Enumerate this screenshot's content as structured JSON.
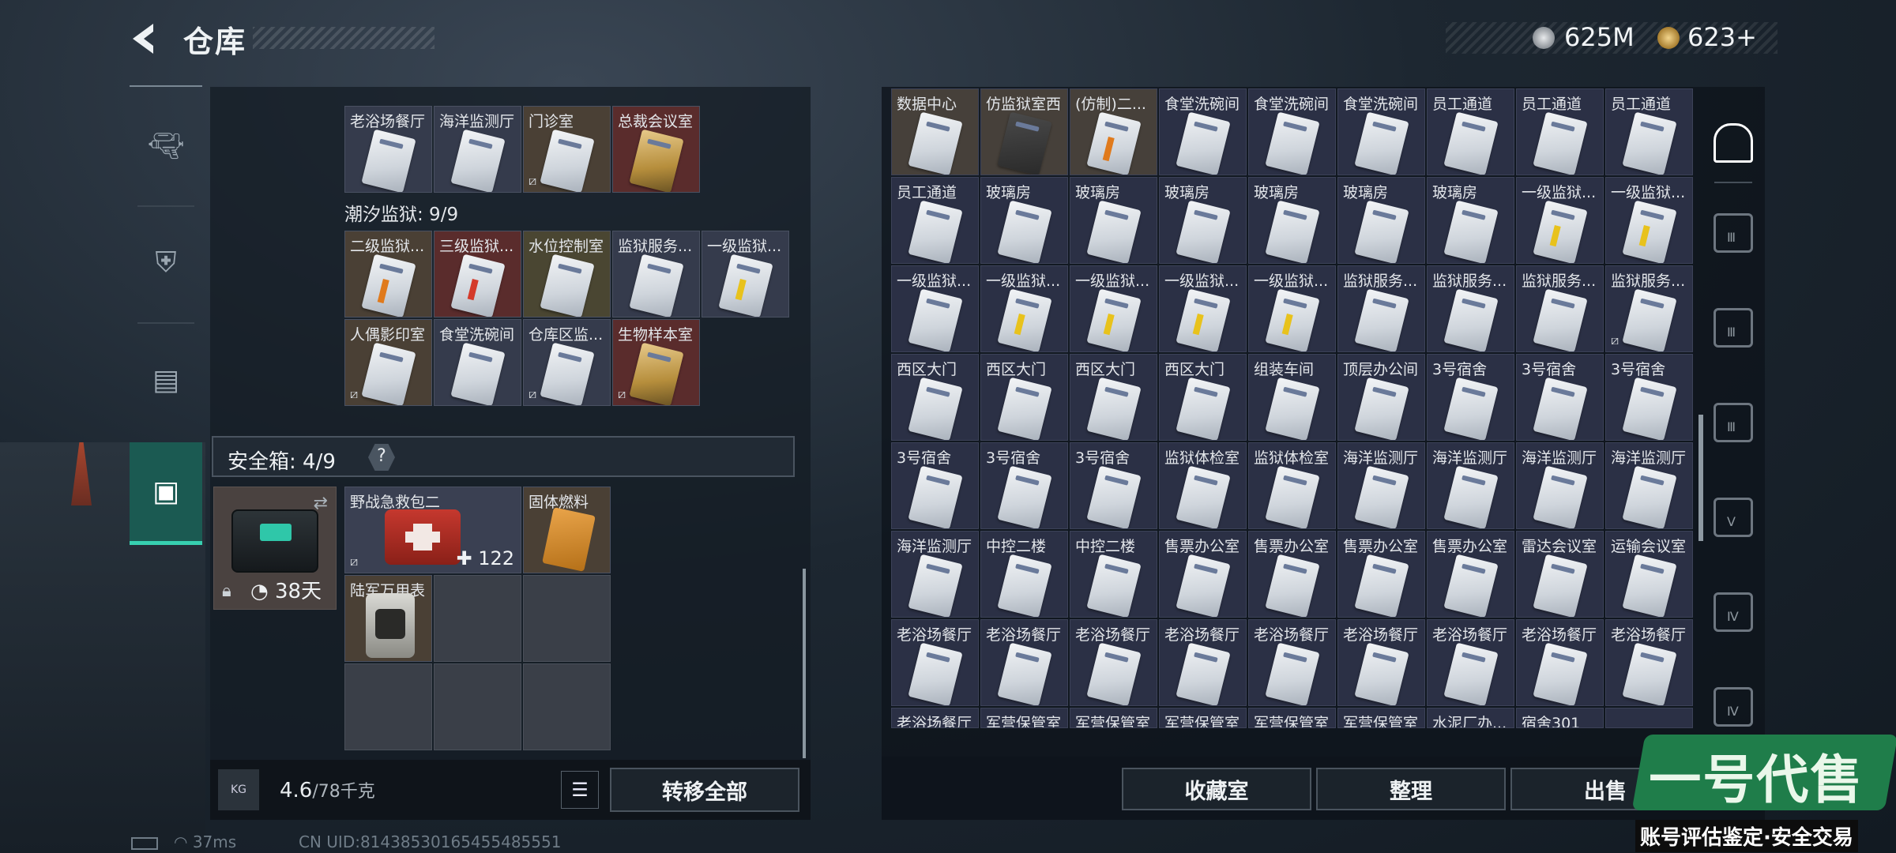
{
  "header": {
    "title": "仓库",
    "currency1": "625M",
    "currency2": "623+"
  },
  "left_nav": {
    "items": [
      "weapon-icon",
      "armor-icon",
      "backpack-icon",
      "case-icon"
    ],
    "active_index": 3
  },
  "stash_row1_labels": [
    "老浴场餐厅",
    "海洋监测厅",
    "门诊室",
    "总裁会议室"
  ],
  "tide_prison": {
    "label": "潮汐监狱: 9/9",
    "row1": [
      "二级监狱...",
      "三级监狱...",
      "水位控制室",
      "监狱服务...",
      "一级监狱..."
    ],
    "row2": [
      "人偶影印室",
      "食堂洗碗间",
      "仓库区监...",
      "生物样本室"
    ]
  },
  "safe": {
    "label": "安全箱: 4/9",
    "help": "?",
    "days": "38天",
    "items": {
      "medkit": "野战急救包二",
      "medkit_qty": "122",
      "fuel": "固体燃料",
      "watch": "陆军万用表"
    }
  },
  "left_bottom": {
    "kg_icon": "KG",
    "weight": "4.6",
    "weight_max": "/78千克",
    "transfer_all": "转移全部"
  },
  "right_grid": [
    [
      "数据中心",
      "仿监狱室西",
      "(仿制)二...",
      "食堂洗碗间",
      "食堂洗碗间",
      "食堂洗碗间",
      "员工通道",
      "员工通道",
      "员工通道"
    ],
    [
      "员工通道",
      "玻璃房",
      "玻璃房",
      "玻璃房",
      "玻璃房",
      "玻璃房",
      "玻璃房",
      "一级监狱...",
      "一级监狱..."
    ],
    [
      "一级监狱...",
      "一级监狱...",
      "一级监狱...",
      "一级监狱...",
      "一级监狱...",
      "监狱服务...",
      "监狱服务...",
      "监狱服务...",
      "监狱服务..."
    ],
    [
      "西区大门",
      "西区大门",
      "西区大门",
      "西区大门",
      "组装车间",
      "顶层办公间",
      "3号宿舍",
      "3号宿舍",
      "3号宿舍"
    ],
    [
      "3号宿舍",
      "3号宿舍",
      "3号宿舍",
      "监狱体检室",
      "监狱体检室",
      "海洋监测厅",
      "海洋监测厅",
      "海洋监测厅",
      "海洋监测厅"
    ],
    [
      "海洋监测厅",
      "中控二楼",
      "中控二楼",
      "售票办公室",
      "售票办公室",
      "售票办公室",
      "售票办公室",
      "雷达会议室",
      "运输会议室"
    ],
    [
      "老浴场餐厅",
      "老浴场餐厅",
      "老浴场餐厅",
      "老浴场餐厅",
      "老浴场餐厅",
      "老浴场餐厅",
      "老浴场餐厅",
      "老浴场餐厅",
      "老浴场餐厅"
    ],
    [
      "老浴场餐厅",
      "军营保管室",
      "军营保管室",
      "军营保管室",
      "军营保管室",
      "军营保管室",
      "水泥厂办...",
      "宿舍301",
      ""
    ]
  ],
  "right_buttons": [
    "收藏室",
    "整理",
    "出售"
  ],
  "right_nav": [
    "house-icon",
    "Ⅲ",
    "Ⅲ",
    "Ⅲ",
    "Ⅴ",
    "Ⅳ",
    "Ⅳ"
  ],
  "status": {
    "ping": "37ms",
    "uid": "CN UID:8143853016545548555​1"
  },
  "watermark": {
    "logo": "一号代售",
    "sub": "账号评估鉴定·安全交易"
  }
}
